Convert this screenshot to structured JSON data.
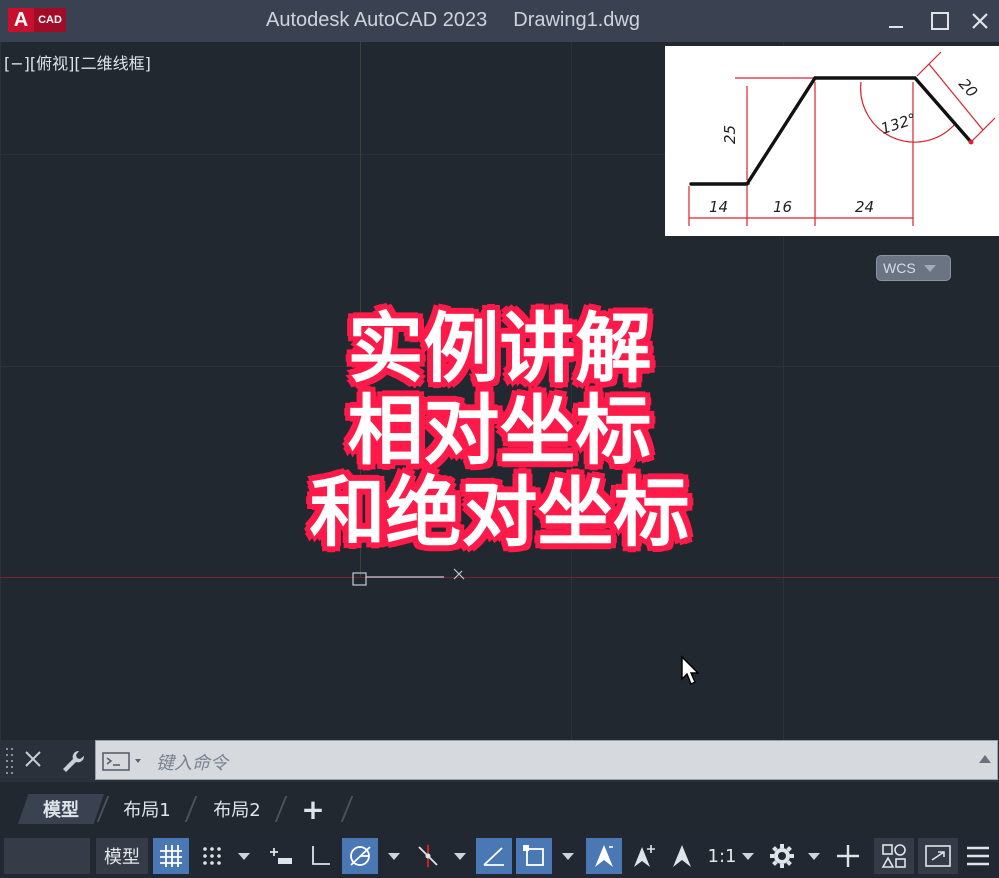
{
  "window": {
    "app_title": "Autodesk AutoCAD 2023",
    "doc_title": "Drawing1.dwg",
    "logo_letter": "A",
    "logo_text": "CAD"
  },
  "viewport": {
    "label": "[−][俯视][二维线框]",
    "wcs_label": "WCS"
  },
  "reference_image": {
    "dims": [
      "25",
      "14",
      "16",
      "24",
      "132°",
      "20"
    ]
  },
  "overlay": {
    "line1": "实例讲解",
    "line2": "相对坐标",
    "line3": "和绝对坐标",
    "stroke_color": "#ff1a4a"
  },
  "command": {
    "placeholder": "键入命令"
  },
  "tabs": {
    "model": "模型",
    "layout1": "布局1",
    "layout2": "布局2",
    "add": "+"
  },
  "status": {
    "model": "模型",
    "scale": "1:1"
  },
  "colors": {
    "accent": "#4a78b5",
    "canvas": "#212830",
    "dimension_red": "#d9232e"
  }
}
